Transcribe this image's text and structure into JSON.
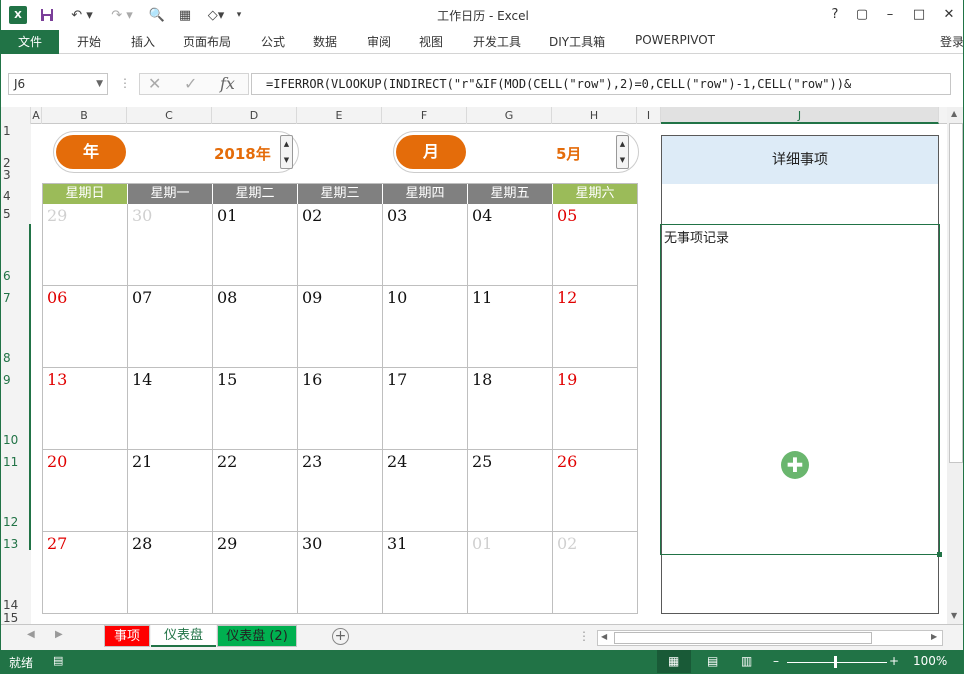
{
  "titlebar": {
    "title": "工作日历 - Excel",
    "help": "?",
    "restore": "▢",
    "minimize": "–",
    "maximize": "□",
    "close": "✕"
  },
  "ribbon": {
    "file": "文件",
    "tabs": [
      "开始",
      "插入",
      "页面布局",
      "公式",
      "数据",
      "审阅",
      "视图",
      "开发工具",
      "DIY工具箱",
      "POWERPIVOT"
    ],
    "login": "登录"
  },
  "formula_bar": {
    "name_box": "J6",
    "formula": "=IFERROR(VLOOKUP(INDIRECT(\"r\"&IF(MOD(CELL(\"row\"),2)=0,CELL(\"row\")-1,CELL(\"row\"))&"
  },
  "columns": [
    "A",
    "B",
    "C",
    "D",
    "E",
    "F",
    "G",
    "H",
    "I",
    "J"
  ],
  "rows": [
    "1",
    "2",
    "3",
    "4",
    "5",
    "6",
    "7",
    "8",
    "9",
    "10",
    "11",
    "12",
    "13",
    "14",
    "15"
  ],
  "year_spinner": {
    "label": "年",
    "value": "2018年"
  },
  "month_spinner": {
    "label": "月",
    "value": "5月"
  },
  "weekdays": [
    "星期日",
    "星期一",
    "星期二",
    "星期三",
    "星期四",
    "星期五",
    "星期六"
  ],
  "calendar": [
    [
      "29",
      "30",
      "01",
      "02",
      "03",
      "04",
      "05"
    ],
    [
      "06",
      "07",
      "08",
      "09",
      "10",
      "11",
      "12"
    ],
    [
      "13",
      "14",
      "15",
      "16",
      "17",
      "18",
      "19"
    ],
    [
      "20",
      "21",
      "22",
      "23",
      "24",
      "25",
      "26"
    ],
    [
      "27",
      "28",
      "29",
      "30",
      "31",
      "01",
      "02"
    ]
  ],
  "calendar_other_month": [
    [
      true,
      true,
      false,
      false,
      false,
      false,
      false
    ],
    [
      false,
      false,
      false,
      false,
      false,
      false,
      false
    ],
    [
      false,
      false,
      false,
      false,
      false,
      false,
      false
    ],
    [
      false,
      false,
      false,
      false,
      false,
      false,
      false
    ],
    [
      false,
      false,
      false,
      false,
      false,
      true,
      true
    ]
  ],
  "detail": {
    "title": "详细事项",
    "content": "无事项记录"
  },
  "sheet_tabs": [
    "事项",
    "仪表盘",
    "仪表盘 (2)"
  ],
  "status": {
    "ready": "就绪",
    "zoom": "100%"
  },
  "colors": {
    "excel_green": "#217346",
    "orange": "#e46c0a",
    "weekend_header": "#9bbb59",
    "weekday_header": "#808080",
    "weekend_text": "#e00000",
    "muted_text": "#d0d0d0",
    "detail_header": "#ddebf7"
  }
}
